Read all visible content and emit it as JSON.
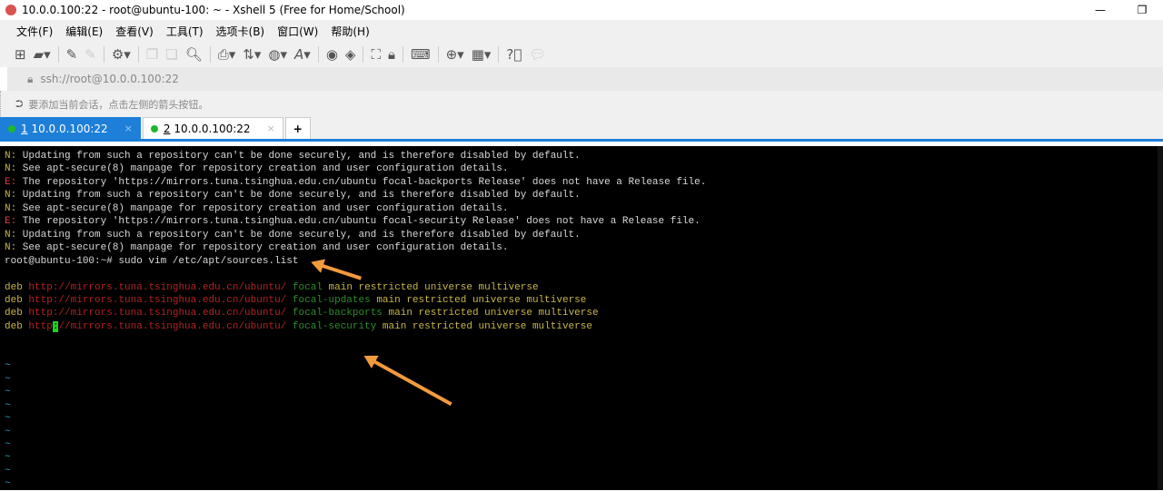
{
  "window": {
    "title": "10.0.0.100:22 - root@ubuntu-100: ~ - Xshell 5 (Free for Home/School)",
    "minimize": "—",
    "restore": "❐"
  },
  "menu": [
    "文件(F)",
    "编辑(E)",
    "查看(V)",
    "工具(T)",
    "选项卡(B)",
    "窗口(W)",
    "帮助(H)"
  ],
  "toolbar_icons": [
    "new-session",
    "open",
    "properties",
    "disconnect",
    "settings",
    "copy",
    "paste",
    "find",
    "print",
    "transfer",
    "globe",
    "font",
    "xftp",
    "xmanager",
    "fullscreen",
    "lock",
    "keyboard",
    "add-tab",
    "layout",
    "help",
    "chat"
  ],
  "address": "ssh://root@10.0.0.100:22",
  "hint": "要添加当前会话，点击左侧的箭头按钮。",
  "tabs": [
    {
      "num": "1",
      "label": "10.0.0.100:22",
      "close": "×"
    },
    {
      "num": "2",
      "label": "10.0.0.100:22",
      "close": "×"
    }
  ],
  "tab_add": "+",
  "terminal": {
    "messages": [
      {
        "p": "N:",
        "t": " Updating from such a repository can't be done securely, and is therefore disabled by default."
      },
      {
        "p": "N:",
        "t": " See apt-secure(8) manpage for repository creation and user configuration details."
      },
      {
        "p": "E:",
        "t": " The repository 'https://mirrors.tuna.tsinghua.edu.cn/ubuntu focal-backports Release' does not have a Release file."
      },
      {
        "p": "N:",
        "t": " Updating from such a repository can't be done securely, and is therefore disabled by default."
      },
      {
        "p": "N:",
        "t": " See apt-secure(8) manpage for repository creation and user configuration details."
      },
      {
        "p": "E:",
        "t": " The repository 'https://mirrors.tuna.tsinghua.edu.cn/ubuntu focal-security Release' does not have a Release file."
      },
      {
        "p": "N:",
        "t": " Updating from such a repository can't be done securely, and is therefore disabled by default."
      },
      {
        "p": "N:",
        "t": " See apt-secure(8) manpage for repository creation and user configuration details."
      }
    ],
    "prompt": "root@ubuntu-100:~# sudo vim /etc/apt/sources.list",
    "sources": [
      {
        "deb": "deb",
        "url": "http://mirrors.tuna.tsinghua.edu.cn/ubuntu/",
        "suite": "focal",
        "comps": "main restricted universe multiverse"
      },
      {
        "deb": "deb",
        "url": "http://mirrors.tuna.tsinghua.edu.cn/ubuntu/",
        "suite": "focal-updates",
        "comps": "main restricted universe multiverse"
      },
      {
        "deb": "deb",
        "url": "http://mirrors.tuna.tsinghua.edu.cn/ubuntu/",
        "suite": "focal-backports",
        "comps": "main restricted universe multiverse"
      },
      {
        "deb": "deb",
        "url_a": "http",
        "cursor": ":",
        "url_b": "//mirrors.tuna.tsinghua.edu.cn/ubuntu/",
        "suite": "focal-security",
        "comps": "main restricted universe multiverse"
      }
    ],
    "tilde": "~",
    "tilde_count": 10
  }
}
